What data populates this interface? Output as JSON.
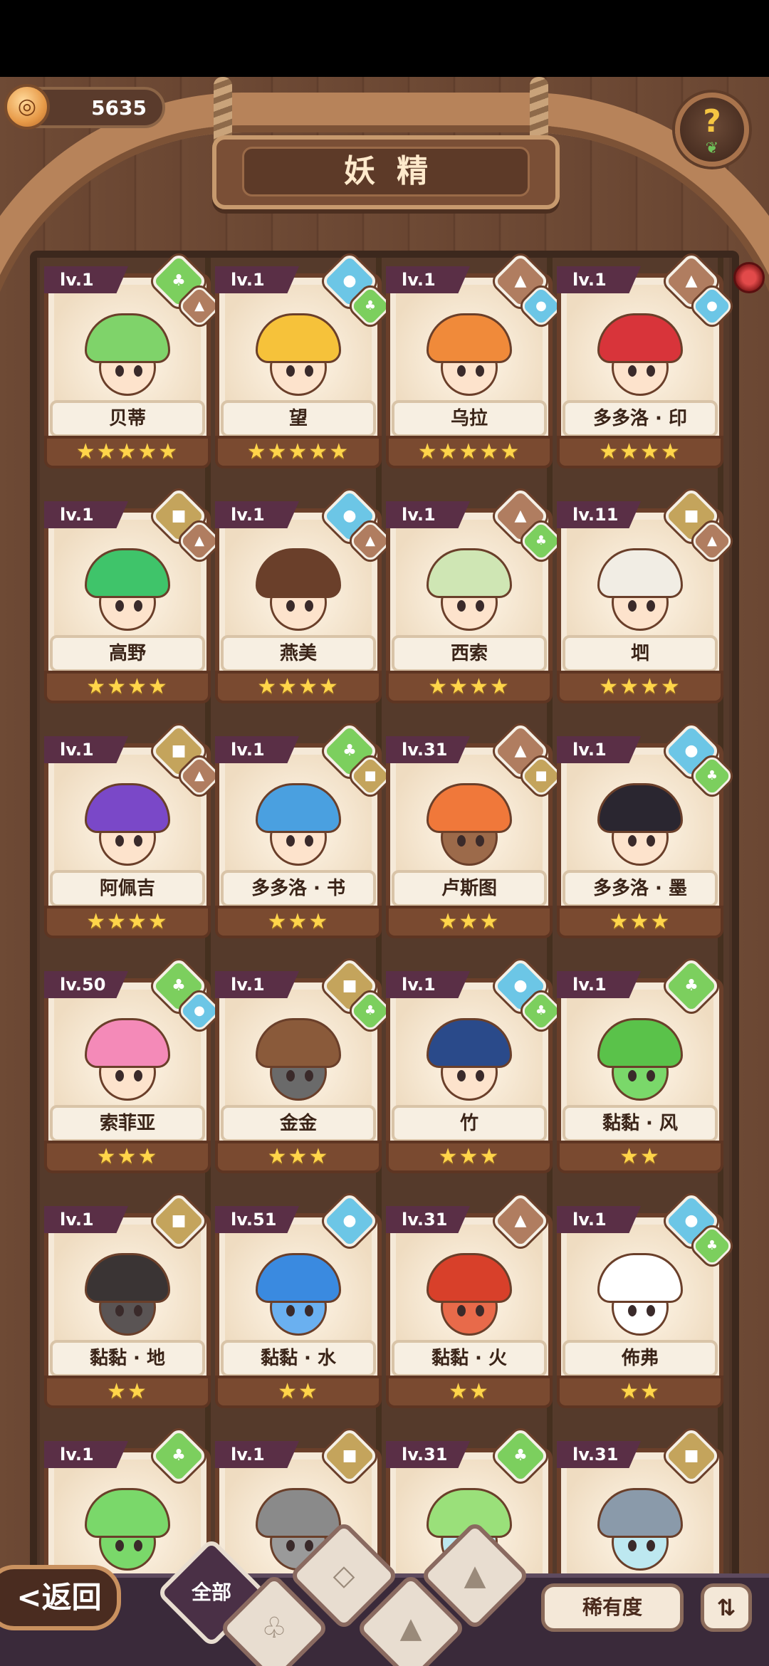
{
  "header": {
    "coin_value": "5635",
    "title": "妖精",
    "help_symbol": "?"
  },
  "cards": [
    {
      "level": "lv.1",
      "name": "贝蒂",
      "stars": 5,
      "stars_text": "★★★★★",
      "element": "grass",
      "element2": "rock",
      "hair_color": "#7fd36a",
      "skin": "#fde3cc"
    },
    {
      "level": "lv.1",
      "name": "望",
      "stars": 5,
      "stars_text": "★★★★★",
      "element": "water",
      "element2": "grass",
      "hair_color": "#f6c23a",
      "skin": "#fde3cc"
    },
    {
      "level": "lv.1",
      "name": "乌拉",
      "stars": 5,
      "stars_text": "★★★★★",
      "element": "rock",
      "element2": "water",
      "hair_color": "#f08a3a",
      "skin": "#fde3cc"
    },
    {
      "level": "lv.1",
      "name": "多多洛 · 印",
      "stars": 4,
      "stars_text": "★★★★",
      "element": "rock",
      "element2": "water",
      "hair_color": "#d8343a",
      "skin": "#fde3cc"
    },
    {
      "level": "lv.1",
      "name": "高野",
      "stars": 4,
      "stars_text": "★★★★",
      "element": "earth",
      "element2": "rock",
      "hair_color": "#3fc46a",
      "skin": "#fde3cc"
    },
    {
      "level": "lv.1",
      "name": "燕美",
      "stars": 4,
      "stars_text": "★★★★",
      "element": "water",
      "element2": "rock",
      "hair_color": "#6a3f2a",
      "skin": "#fde3cc"
    },
    {
      "level": "lv.1",
      "name": "西索",
      "stars": 4,
      "stars_text": "★★★★",
      "element": "rock",
      "element2": "grass",
      "hair_color": "#cfe6b4",
      "skin": "#fde3cc"
    },
    {
      "level": "lv.11",
      "name": "垇",
      "stars": 4,
      "stars_text": "★★★★",
      "element": "earth",
      "element2": "rock",
      "hair_color": "#f1ede4",
      "skin": "#fde3cc"
    },
    {
      "level": "lv.1",
      "name": "阿佩吉",
      "stars": 4,
      "stars_text": "★★★★",
      "element": "earth",
      "element2": "rock",
      "hair_color": "#7a48c8",
      "skin": "#fde3cc"
    },
    {
      "level": "lv.1",
      "name": "多多洛 · 书",
      "stars": 3,
      "stars_text": "★★★",
      "element": "grass",
      "element2": "earth",
      "hair_color": "#4aa0e0",
      "skin": "#fde3cc"
    },
    {
      "level": "lv.31",
      "name": "卢斯图",
      "stars": 3,
      "stars_text": "★★★",
      "element": "rock",
      "element2": "earth",
      "hair_color": "#f0783a",
      "skin": "#9c6a4a"
    },
    {
      "level": "lv.1",
      "name": "多多洛 · 墨",
      "stars": 3,
      "stars_text": "★★★",
      "element": "water",
      "element2": "grass",
      "hair_color": "#2a2630",
      "skin": "#fde3cc"
    },
    {
      "level": "lv.50",
      "name": "索菲亚",
      "stars": 3,
      "stars_text": "★★★",
      "element": "grass",
      "element2": "water",
      "hair_color": "#f48ab8",
      "skin": "#fde3cc"
    },
    {
      "level": "lv.1",
      "name": "金金",
      "stars": 3,
      "stars_text": "★★★",
      "element": "earth",
      "element2": "grass",
      "hair_color": "#8a5a3a",
      "skin": "#6a6a6a"
    },
    {
      "level": "lv.1",
      "name": "竹",
      "stars": 3,
      "stars_text": "★★★",
      "element": "water",
      "element2": "grass",
      "hair_color": "#2a4a8a",
      "skin": "#fde3cc"
    },
    {
      "level": "lv.1",
      "name": "黏黏 · 风",
      "stars": 2,
      "stars_text": "★★",
      "element": "grass",
      "element2": "",
      "hair_color": "#5ac24a",
      "skin": "#7ad86a"
    },
    {
      "level": "lv.1",
      "name": "黏黏 · 地",
      "stars": 2,
      "stars_text": "★★",
      "element": "earth",
      "element2": "",
      "hair_color": "#3a3434",
      "skin": "#5a5454"
    },
    {
      "level": "lv.51",
      "name": "黏黏 · 水",
      "stars": 2,
      "stars_text": "★★",
      "element": "water",
      "element2": "",
      "hair_color": "#3a8ae0",
      "skin": "#6ab0f0"
    },
    {
      "level": "lv.31",
      "name": "黏黏 · 火",
      "stars": 2,
      "stars_text": "★★",
      "element": "rock",
      "element2": "",
      "hair_color": "#d8402a",
      "skin": "#e86a4a"
    },
    {
      "level": "lv.1",
      "name": "佈弗",
      "stars": 2,
      "stars_text": "★★",
      "element": "water",
      "element2": "grass",
      "hair_color": "#ffffff",
      "skin": "#ffffff"
    },
    {
      "level": "lv.1",
      "name": "",
      "stars": 0,
      "stars_text": "",
      "element": "grass",
      "element2": "",
      "hair_color": "#7ad86a",
      "skin": "#7ad86a"
    },
    {
      "level": "lv.1",
      "name": "",
      "stars": 0,
      "stars_text": "",
      "element": "earth",
      "element2": "",
      "hair_color": "#8a8a8a",
      "skin": "#9a9a9a"
    },
    {
      "level": "lv.31",
      "name": "",
      "stars": 0,
      "stars_text": "",
      "element": "grass",
      "element2": "",
      "hair_color": "#9ae07a",
      "skin": "#bde8f0"
    },
    {
      "level": "lv.31",
      "name": "",
      "stars": 0,
      "stars_text": "",
      "element": "earth",
      "element2": "",
      "hair_color": "#8a9aaa",
      "skin": "#bde8f0"
    }
  ],
  "bottom": {
    "back_label": "<返回",
    "tab_all_label": "全部",
    "tabs": [
      {
        "name": "grass",
        "icon": "sprout-icon"
      },
      {
        "name": "water",
        "icon": "droplet-icon"
      },
      {
        "name": "earth",
        "icon": "mountain-icon"
      },
      {
        "name": "rock",
        "icon": "peak-icon"
      }
    ],
    "rarity_label": "稀有度",
    "sort_label": "⇅"
  },
  "colors": {
    "grass": "#7ccf5e",
    "water": "#6cc6e6",
    "rock": "#b07d60",
    "earth": "#c4a45c",
    "level_tag": "#5a2f46",
    "star": "#ffd54a"
  }
}
